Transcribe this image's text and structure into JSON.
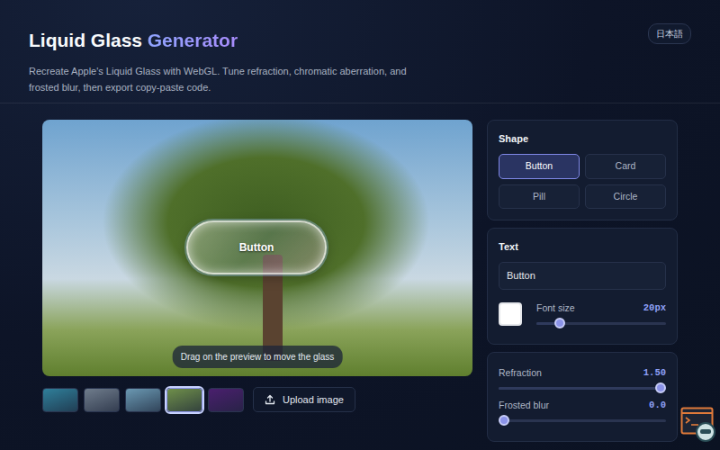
{
  "header": {
    "title": "Liquid Glass",
    "title_accent": "Generator",
    "subtitle": "Recreate Apple's Liquid Glass with WebGL. Tune refraction, chromatic aberration, and frosted blur, then export copy-paste code.",
    "language_button": "日本語"
  },
  "preview": {
    "glass_label": "Button",
    "hint": "Drag on the preview to move the glass"
  },
  "backgrounds": [
    {
      "selected": false,
      "color": "#2f7f9a"
    },
    {
      "selected": false,
      "color": "#6f7c8c"
    },
    {
      "selected": false,
      "color": "#6a98b2"
    },
    {
      "selected": true,
      "color": "#6f8f4a"
    },
    {
      "selected": false,
      "color": "#4a1f6e"
    }
  ],
  "upload_button": "Upload image",
  "shape": {
    "title": "Shape",
    "options": [
      {
        "label": "Button",
        "selected": true
      },
      {
        "label": "Card",
        "selected": false
      },
      {
        "label": "Pill",
        "selected": false
      },
      {
        "label": "Circle",
        "selected": false
      }
    ]
  },
  "text": {
    "title": "Text",
    "value": "Button",
    "swatch_color": "#ffffff",
    "font_size_label": "Font size",
    "font_size_reading": "20px",
    "font_size_level": 0.15
  },
  "sliders": [
    {
      "label": "Refraction",
      "reading": "1.50",
      "level": 1
    },
    {
      "label": "Frosted blur",
      "reading": "0.0",
      "level": 0
    }
  ]
}
